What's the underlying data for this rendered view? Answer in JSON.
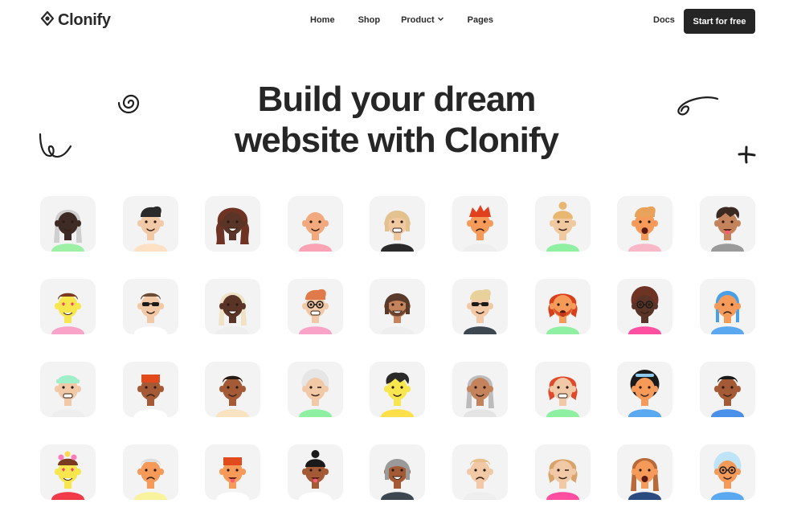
{
  "brand": {
    "name": "Clonify"
  },
  "nav": {
    "items": [
      {
        "label": "Home",
        "has_dropdown": false
      },
      {
        "label": "Shop",
        "has_dropdown": false
      },
      {
        "label": "Product",
        "has_dropdown": true
      },
      {
        "label": "Pages",
        "has_dropdown": false
      }
    ],
    "docs_label": "Docs",
    "cta_label": "Start for free"
  },
  "hero": {
    "line1": "Build your dream",
    "line2": "website  with Clonify"
  },
  "avatars": [
    {
      "skin": "#3e2b25",
      "hair": "#cfcfcf",
      "hair_style": "long",
      "shirt": "#9ef0a6",
      "expr": "smile",
      "acc": "none"
    },
    {
      "skin": "#f2c9a6",
      "hair": "#2a2a2a",
      "hair_style": "quiff",
      "shirt": "#fde1c4",
      "expr": "smile",
      "acc": "none"
    },
    {
      "skin": "#5a3426",
      "hair": "#6e3322",
      "hair_style": "curly-long",
      "shirt": "#f3f3f3",
      "expr": "grin",
      "acc": "none"
    },
    {
      "skin": "#f2a97e",
      "hair": "none",
      "hair_style": "bald",
      "shirt": "#f9a3b5",
      "expr": "smile",
      "acc": "none"
    },
    {
      "skin": "#f0c9a0",
      "hair": "#e3c28f",
      "hair_style": "bob",
      "shirt": "#2a2a2a",
      "expr": "grimace",
      "acc": "none"
    },
    {
      "skin": "#f59a59",
      "hair": "#e0401c",
      "hair_style": "spiky",
      "shirt": "#eeeeee",
      "expr": "sad",
      "acc": "none"
    },
    {
      "skin": "#f0c9a0",
      "hair": "#e8b873",
      "hair_style": "bun",
      "shirt": "#8ff0a4",
      "expr": "wink",
      "acc": "none"
    },
    {
      "skin": "#f59a59",
      "hair": "#e8a25a",
      "hair_style": "quiff",
      "shirt": "#f9b8c8",
      "expr": "shout",
      "acc": "none"
    },
    {
      "skin": "#c4835a",
      "hair": "#3a2a22",
      "hair_style": "messy",
      "shirt": "#9a9a9a",
      "expr": "tongue",
      "acc": "none"
    },
    {
      "skin": "#f7e64e",
      "hair": "#7a3a20",
      "hair_style": "short",
      "shirt": "#f9a3c8",
      "expr": "love",
      "acc": "none"
    },
    {
      "skin": "#f2c9a6",
      "hair": "#6b4a33",
      "hair_style": "short",
      "shirt": "#ffffff",
      "expr": "smile",
      "acc": "shades"
    },
    {
      "skin": "#5a3426",
      "hair": "#f0e2c4",
      "hair_style": "long",
      "shirt": "#eeeeee",
      "expr": "grin",
      "acc": "none"
    },
    {
      "skin": "#f2c9a6",
      "hair": "#e07a4a",
      "hair_style": "quiff",
      "shirt": "#f9a3c8",
      "expr": "grimace",
      "acc": "glasses"
    },
    {
      "skin": "#c4835a",
      "hair": "#5a3a2a",
      "hair_style": "bob",
      "shirt": "#eeeeee",
      "expr": "grin",
      "acc": "beard"
    },
    {
      "skin": "#f2c9a6",
      "hair": "#e8d19a",
      "hair_style": "quiff",
      "shirt": "#3d4750",
      "expr": "smile",
      "acc": "shades"
    },
    {
      "skin": "#f59a59",
      "hair": "#d8401c",
      "hair_style": "curly",
      "shirt": "#8ff0a4",
      "expr": "shout",
      "acc": "beard"
    },
    {
      "skin": "#5a3426",
      "hair": "#6e3322",
      "hair_style": "afro",
      "shirt": "#ff4fa0",
      "expr": "smile",
      "acc": "glasses"
    },
    {
      "skin": "#f59a59",
      "hair": "#4aa0e8",
      "hair_style": "beanie",
      "shirt": "#5aa8f0",
      "expr": "sad",
      "acc": "none"
    },
    {
      "skin": "#f2c9a6",
      "hair": "#9ff0c8",
      "hair_style": "cap",
      "shirt": "#eeeeee",
      "expr": "grimace",
      "acc": "none"
    },
    {
      "skin": "#a55a36",
      "hair": "#e04a1c",
      "hair_style": "flat",
      "shirt": "#ffffff",
      "expr": "sad",
      "acc": "none"
    },
    {
      "skin": "#a55a36",
      "hair": "#2a1a14",
      "hair_style": "short",
      "shirt": "#f9e3c0",
      "expr": "smile",
      "acc": "none"
    },
    {
      "skin": "#f2c9a6",
      "hair": "#e6e6e6",
      "hair_style": "afro",
      "shirt": "#8ff0a4",
      "expr": "wink",
      "acc": "none"
    },
    {
      "skin": "#f7e64e",
      "hair": "#2a2a2a",
      "hair_style": "messy",
      "shirt": "#ffe04a",
      "expr": "smile",
      "acc": "none"
    },
    {
      "skin": "#c4835a",
      "hair": "#bcbcbc",
      "hair_style": "long",
      "shirt": "#e4e4e4",
      "expr": "smile",
      "acc": "none"
    },
    {
      "skin": "#f2c9a6",
      "hair": "#e04a2a",
      "hair_style": "curly",
      "shirt": "#8ff0a4",
      "expr": "grimace",
      "acc": "none"
    },
    {
      "skin": "#f59a59",
      "hair": "#1a1a1a",
      "hair_style": "afro-band",
      "shirt": "#5aa8f0",
      "expr": "smile",
      "acc": "none"
    },
    {
      "skin": "#a55a36",
      "hair": "#1a1a1a",
      "hair_style": "short",
      "shirt": "#4a90e8",
      "expr": "smile",
      "acc": "none"
    },
    {
      "skin": "#f7e64e",
      "hair": "#7a3a20",
      "hair_style": "flowers",
      "shirt": "#f03a4a",
      "expr": "love",
      "acc": "none"
    },
    {
      "skin": "#f59a59",
      "hair": "#dddddd",
      "hair_style": "short",
      "shirt": "#f9f3a0",
      "expr": "sad",
      "acc": "none"
    },
    {
      "skin": "#f59a59",
      "hair": "#e04a1c",
      "hair_style": "flat",
      "shirt": "#ffffff",
      "expr": "tongue",
      "acc": "none"
    },
    {
      "skin": "#a55a36",
      "hair": "#1a1a1a",
      "hair_style": "bun",
      "shirt": "#ffffff",
      "expr": "tongue",
      "acc": "none"
    },
    {
      "skin": "#a55a36",
      "hair": "#9a9a9a",
      "hair_style": "bob",
      "shirt": "#3d4750",
      "expr": "grin",
      "acc": "none"
    },
    {
      "skin": "#f2c9a6",
      "hair": "#e6c08f",
      "hair_style": "short",
      "shirt": "#eeeeee",
      "expr": "sad",
      "acc": "none"
    },
    {
      "skin": "#f2c9a6",
      "hair": "#d9a46a",
      "hair_style": "curly",
      "shirt": "#ff4fa0",
      "expr": "wink",
      "acc": "none"
    },
    {
      "skin": "#f59a59",
      "hair": "#b86a3a",
      "hair_style": "long",
      "shirt": "#2a4a80",
      "expr": "shout",
      "acc": "none"
    },
    {
      "skin": "#f59a59",
      "hair": "#bfe4f8",
      "hair_style": "afro",
      "shirt": "#5aa8f0",
      "expr": "smile",
      "acc": "glasses"
    }
  ]
}
